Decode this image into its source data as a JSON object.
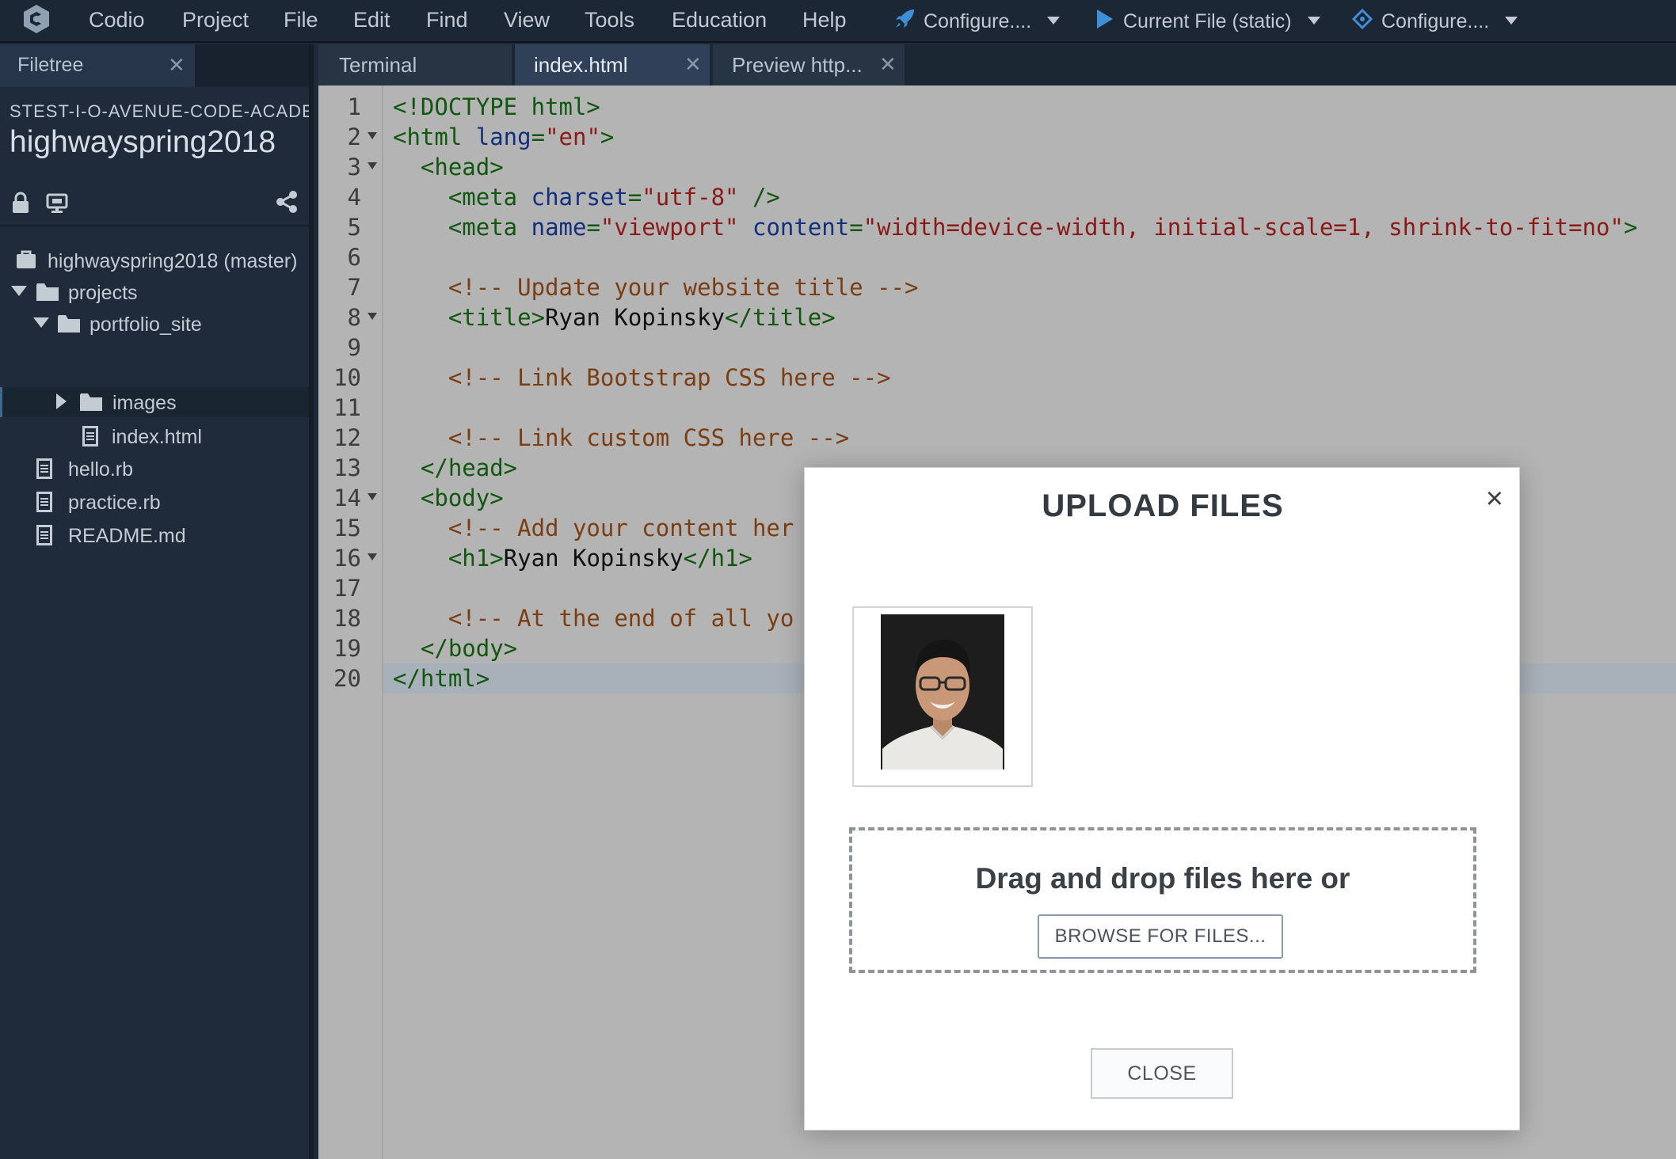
{
  "menubar": {
    "items": [
      "Codio",
      "Project",
      "File",
      "Edit",
      "Find",
      "View",
      "Tools",
      "Education",
      "Help"
    ],
    "runners": [
      "Configure....",
      "Current File (static)",
      "Configure...."
    ]
  },
  "sidebar": {
    "tab_label": "Filetree",
    "org": "STEST-I-O-AVENUE-CODE-ACADEMY",
    "project": "highwayspring2018",
    "tree": [
      {
        "label": "highwayspring2018 (master)",
        "kind": "repo"
      },
      {
        "label": "projects",
        "kind": "folder-open"
      },
      {
        "label": "portfolio_site",
        "kind": "folder-open"
      },
      {
        "label": "images",
        "kind": "folder-closed"
      },
      {
        "label": "index.html",
        "kind": "file"
      },
      {
        "label": "hello.rb",
        "kind": "file"
      },
      {
        "label": "practice.rb",
        "kind": "file"
      },
      {
        "label": "README.md",
        "kind": "file"
      }
    ]
  },
  "editor": {
    "tabs": [
      "Terminal",
      "index.html",
      "Preview http..."
    ],
    "active_tab": "index.html",
    "current_line": 20,
    "lines": [
      {
        "n": "1",
        "fold": false,
        "tokens": [
          [
            "tag",
            "<!DOCTYPE html>"
          ]
        ]
      },
      {
        "n": "2",
        "fold": true,
        "tokens": [
          [
            "tag",
            "<html "
          ],
          [
            "attr",
            "lang"
          ],
          [
            "tag",
            "="
          ],
          [
            "str",
            "\"en\""
          ],
          [
            "tag",
            ">"
          ]
        ]
      },
      {
        "n": "3",
        "fold": true,
        "tokens": [
          [
            "tag",
            "  <head>"
          ]
        ]
      },
      {
        "n": "4",
        "fold": false,
        "tokens": [
          [
            "tag",
            "    <meta "
          ],
          [
            "attr",
            "charset"
          ],
          [
            "tag",
            "="
          ],
          [
            "str",
            "\"utf-8\""
          ],
          [
            "tag",
            " />"
          ]
        ]
      },
      {
        "n": "5",
        "fold": false,
        "tokens": [
          [
            "tag",
            "    <meta "
          ],
          [
            "attr",
            "name"
          ],
          [
            "tag",
            "="
          ],
          [
            "str",
            "\"viewport\""
          ],
          [
            "tag",
            " "
          ],
          [
            "attr",
            "content"
          ],
          [
            "tag",
            "="
          ],
          [
            "str",
            "\"width=device-width, initial-scale=1, shrink-to-fit=no\""
          ],
          [
            "tag",
            ">"
          ]
        ]
      },
      {
        "n": "6",
        "fold": false,
        "tokens": []
      },
      {
        "n": "7",
        "fold": false,
        "tokens": [
          [
            "com",
            "    <!-- Update your website title -->"
          ]
        ]
      },
      {
        "n": "8",
        "fold": true,
        "tokens": [
          [
            "tag",
            "    <title>"
          ],
          [
            "txt",
            "Ryan Kopinsky"
          ],
          [
            "tag",
            "</title>"
          ]
        ]
      },
      {
        "n": "9",
        "fold": false,
        "tokens": []
      },
      {
        "n": "10",
        "fold": false,
        "tokens": [
          [
            "com",
            "    <!-- Link Bootstrap CSS here -->"
          ]
        ]
      },
      {
        "n": "11",
        "fold": false,
        "tokens": []
      },
      {
        "n": "12",
        "fold": false,
        "tokens": [
          [
            "com",
            "    <!-- Link custom CSS here -->"
          ]
        ]
      },
      {
        "n": "13",
        "fold": false,
        "tokens": [
          [
            "tag",
            "  </head>"
          ]
        ]
      },
      {
        "n": "14",
        "fold": true,
        "tokens": [
          [
            "tag",
            "  <body>"
          ]
        ]
      },
      {
        "n": "15",
        "fold": false,
        "tokens": [
          [
            "com",
            "    <!-- Add your content her"
          ]
        ]
      },
      {
        "n": "16",
        "fold": true,
        "tokens": [
          [
            "tag",
            "    <h1>"
          ],
          [
            "txt",
            "Ryan Kopinsky"
          ],
          [
            "tag",
            "</h1>"
          ]
        ]
      },
      {
        "n": "17",
        "fold": false,
        "tokens": []
      },
      {
        "n": "18",
        "fold": false,
        "tokens": [
          [
            "com",
            "    <!-- At the end of all yo"
          ]
        ]
      },
      {
        "n": "19",
        "fold": false,
        "tokens": [
          [
            "tag",
            "  </body>"
          ]
        ]
      },
      {
        "n": "20",
        "fold": false,
        "tokens": [
          [
            "tag",
            "</html>"
          ]
        ]
      }
    ]
  },
  "modal": {
    "title": "UPLOAD FILES",
    "close_x": "×",
    "drop_text": "Drag and drop files here or",
    "browse_label": "BROWSE FOR FILES...",
    "close_label": "CLOSE"
  },
  "colors": {
    "menubar_bg": "#1c2735",
    "sidebar_bg": "#1f2b3a",
    "editor_bg": "#b4b4b4",
    "accent_blue": "#3f8fd6"
  }
}
